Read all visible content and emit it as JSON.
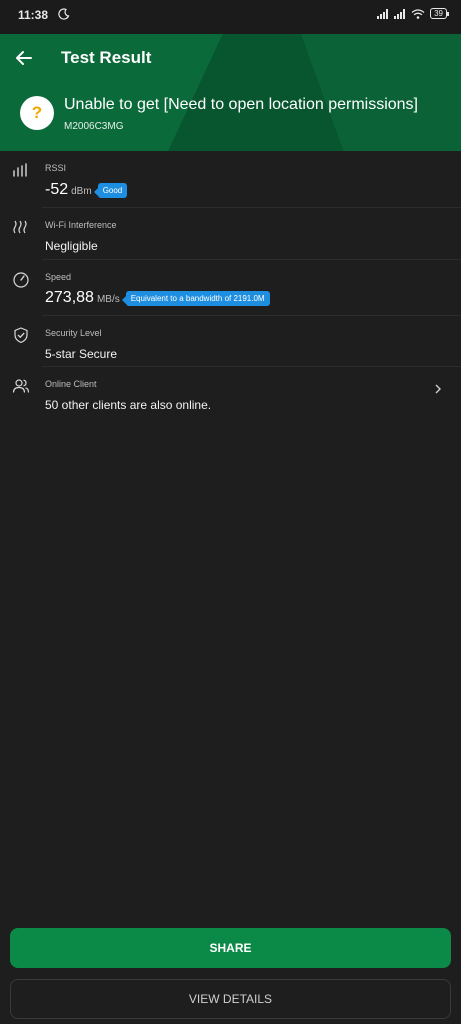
{
  "status_bar": {
    "time": "11:38",
    "battery": "39"
  },
  "header": {
    "title": "Test Result",
    "network_name": "Unable to get [Need to open location permissions]",
    "device_model": "M2006C3MG",
    "unknown_symbol": "?"
  },
  "rows": {
    "rssi": {
      "label": "RSSI",
      "value": "-52",
      "unit": "dBm",
      "badge": "Good"
    },
    "interference": {
      "label": "Wi-Fi Interference",
      "value": "Negligible"
    },
    "speed": {
      "label": "Speed",
      "value": "273,88",
      "unit": "MB/s",
      "badge": "Equivalent to a bandwidth of 2191.0M"
    },
    "security": {
      "label": "Security Level",
      "value": "5-star Secure"
    },
    "clients": {
      "label": "Online Client",
      "value": "50 other clients are also online."
    }
  },
  "buttons": {
    "share": "SHARE",
    "view_details": "VIEW DETAILS"
  },
  "colors": {
    "header_green": "#0b6a3a",
    "accent_green": "#0a8a46",
    "badge_blue": "#1e8ee0",
    "background": "#1e1e1e"
  },
  "icons": [
    "moon-icon",
    "signal-icon",
    "wifi-icon",
    "battery-icon",
    "back-arrow-icon",
    "question-icon",
    "signal-bars-icon",
    "heat-waves-icon",
    "speedometer-icon",
    "shield-check-icon",
    "users-icon",
    "chevron-right-icon"
  ]
}
